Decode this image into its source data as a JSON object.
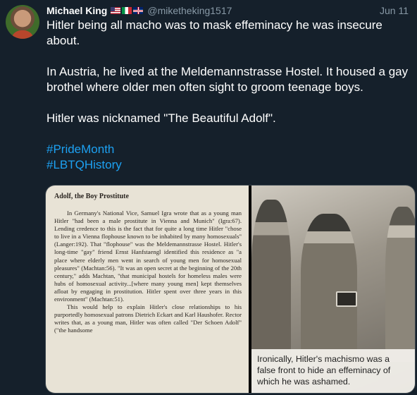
{
  "tweet": {
    "author_name": "Michael King",
    "flags": [
      "flag-us-icon",
      "flag-it-icon",
      "flag-uk-icon"
    ],
    "handle": "@miketheking1517",
    "date": "Jun 11",
    "paragraphs": [
      "Hitler being all macho was to mask effeminacy he was insecure about.",
      "In Austria, he lived at the Meldemannstrasse Hostel. It housed a gay brothel where older men often sight to groom teenage boys.",
      "Hitler was nicknamed \"The Beautiful Adolf\"."
    ],
    "hashtags": [
      "#PrideMonth",
      "#LBTQHistory"
    ]
  },
  "media": {
    "book_page": {
      "title": "Adolf, the Boy Prostitute",
      "paragraphs": [
        "In Germany's National Vice, Samuel Igra wrote that as a young man Hitler \"had been a male prostitute in Vienna and Munich\" (Igra:67). Lending credence to this is the fact that for quite a long time Hitler \"chose to live in a Vienna flophouse known to be inhabited by many homosexuals\" (Langer:192). That \"flophouse\" was the Meldemannstrasse Hostel. Hitler's long-time \"gay\" friend Ernst Hanfstaengl identified this residence as \"a place where elderly men went in search of young men for homosexual pleasures\" (Machtan:56). \"It was an open secret at the beginning of the 20th century,\" adds Machtan, \"that municipal hostels for homeless males were hubs of homosexual activity...[where many young men] kept themselves afloat by engaging in prostitution. Hitler spent over three years in this environment\" (Machtan:51).",
        "This would help to explain Hitler's close relationships to his purportedly homosexual patrons Dietrich Eckart and Karl Haushofer. Rector writes that, as a young man, Hitler was often called \"Der Schoen Adolf\" (\"the handsome"
      ]
    },
    "photo_caption": "Ironically, Hitler's machismo was a false front to hide an effeminacy of which he was ashamed."
  }
}
